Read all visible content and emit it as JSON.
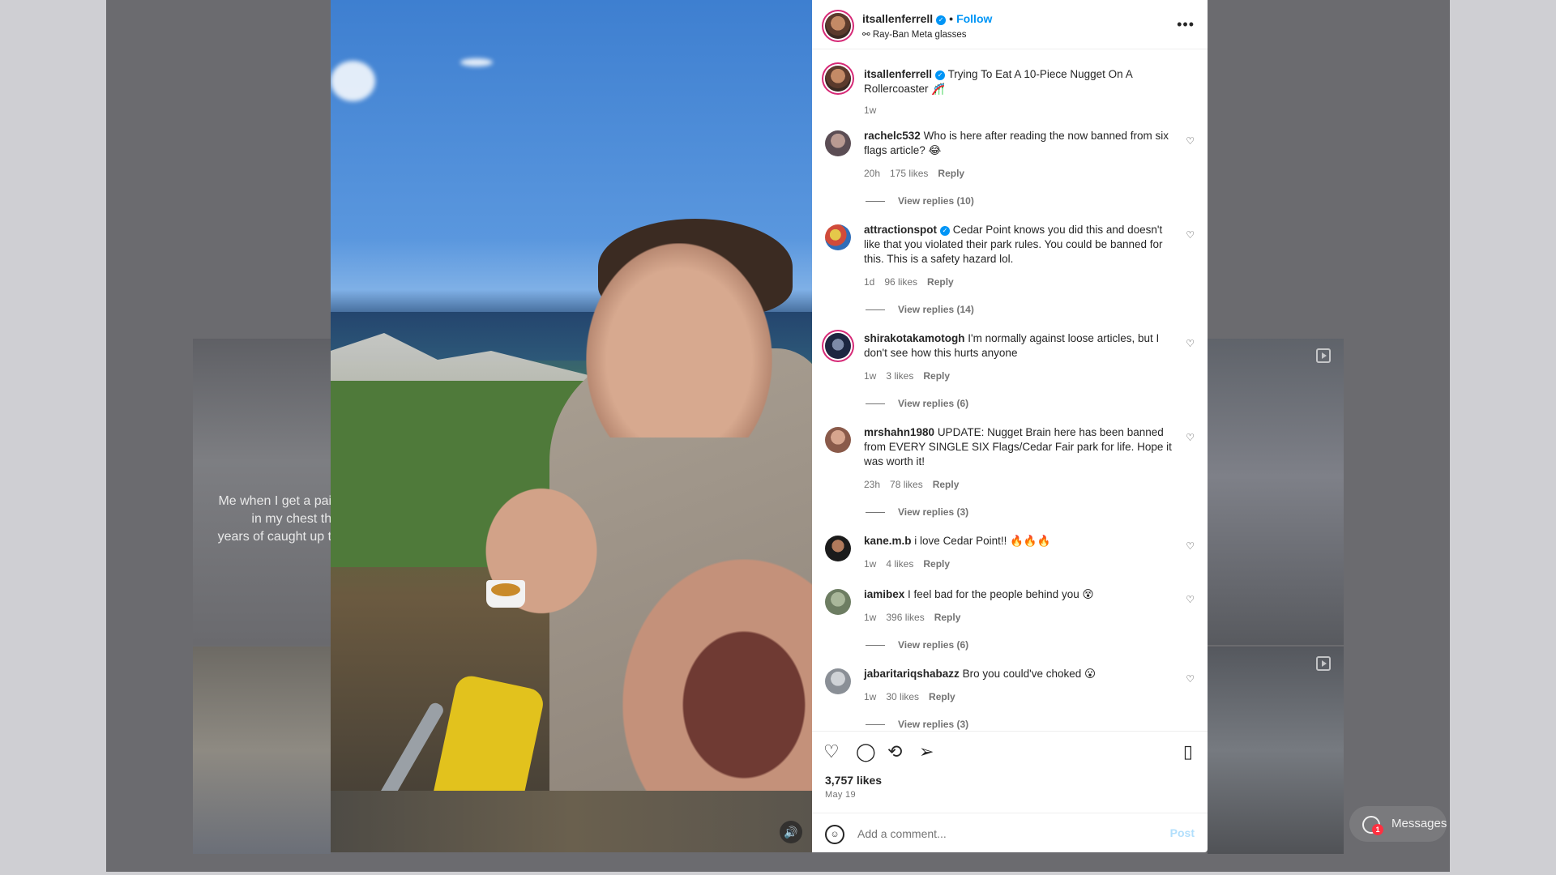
{
  "background": {
    "left_caption": "Me when I get a pain in my chest the years of caught up to"
  },
  "post": {
    "username": "itsallenferrell",
    "follow_label": "Follow",
    "subtitle": "Ray-Ban Meta glasses",
    "caption_username": "itsallenferrell",
    "caption_text": "Trying To Eat A 10-Piece Nugget On A Rollercoaster 🎢",
    "caption_time": "1w",
    "likes": "3,757 likes",
    "date": "May 19"
  },
  "comments": [
    {
      "user": "rachelc532",
      "text": "Who is here after reading the now banned from six flags article? 😂",
      "time": "20h",
      "likes": "175 likes",
      "reply": "Reply",
      "replies": "View replies (10)"
    },
    {
      "user": "attractionspot",
      "verified": true,
      "text": "Cedar Point knows you did this and doesn't like that you violated their park rules. You could be banned for this. This is a safety hazard lol.",
      "time": "1d",
      "likes": "96 likes",
      "reply": "Reply",
      "replies": "View replies (14)"
    },
    {
      "user": "shirakotakamotogh",
      "text": "I'm normally against loose articles, but I don't see how this hurts anyone",
      "time": "1w",
      "likes": "3 likes",
      "reply": "Reply",
      "replies": "View replies (6)"
    },
    {
      "user": "mrshahn1980",
      "text": "UPDATE: Nugget Brain here has been banned from EVERY SINGLE SIX Flags/Cedar Fair park for life. Hope it was worth it!",
      "time": "23h",
      "likes": "78 likes",
      "reply": "Reply",
      "replies": "View replies (3)"
    },
    {
      "user": "kane.m.b",
      "text": "i love Cedar Point!! 🔥🔥🔥",
      "time": "1w",
      "likes": "4 likes",
      "reply": "Reply",
      "replies": ""
    },
    {
      "user": "iamibex",
      "text": "I feel bad for the people behind you 😵",
      "time": "1w",
      "likes": "396 likes",
      "reply": "Reply",
      "replies": "View replies (6)"
    },
    {
      "user": "jabaritariqshabazz",
      "text": "Bro you could've choked 😮",
      "time": "1w",
      "likes": "30 likes",
      "reply": "Reply",
      "replies": "View replies (3)"
    }
  ],
  "composer": {
    "placeholder": "Add a comment...",
    "post_label": "Post"
  },
  "messages": {
    "label": "Messages",
    "badge": "1"
  },
  "icons": {
    "verified": "verified-badge-icon",
    "more": "more-options-icon",
    "like": "heart-icon",
    "comment": "comment-icon",
    "repost": "repost-icon",
    "share": "share-icon",
    "save": "bookmark-icon",
    "mute": "speaker-icon",
    "emoji": "emoji-icon"
  },
  "colors": {
    "accent": "#0095f6",
    "post_disabled": "#b2dffc",
    "badge": "#ff3040"
  }
}
